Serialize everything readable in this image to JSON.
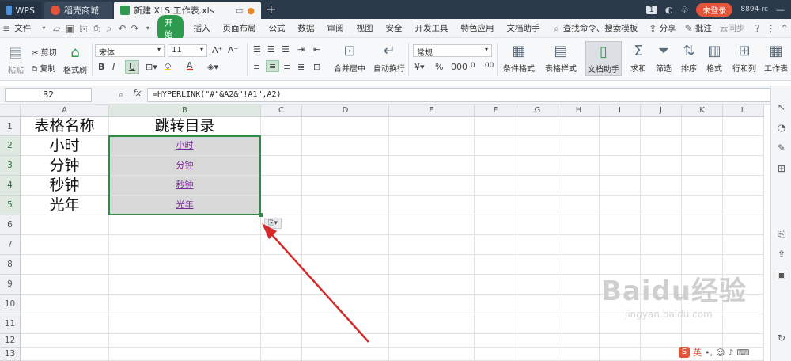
{
  "titlebar": {
    "app_tab": "WPS",
    "store_tab": "稻壳商城",
    "file_tab": "新建 XLS 工作表.xls",
    "badge": "1",
    "login": "未登录",
    "user": "8894-rc"
  },
  "menu": {
    "file": "文件",
    "start": "开始",
    "items": [
      "插入",
      "页面布局",
      "公式",
      "数据",
      "审阅",
      "视图",
      "安全",
      "开发工具",
      "特色应用",
      "文档助手"
    ],
    "search": "查找命令、搜索模板",
    "share": "分享",
    "comment": "批注",
    "sync": "云同步"
  },
  "ribbon": {
    "paste": "粘贴",
    "cut": "剪切",
    "copy": "复制",
    "format_painter": "格式刷",
    "font_name": "宋体",
    "font_size": "11",
    "merge_center": "合并居中",
    "wrap": "自动换行",
    "number_format": "常规",
    "cond_format": "条件格式",
    "table_style": "表格样式",
    "doc_assist": "文档助手",
    "sum": "求和",
    "filter": "筛选",
    "sort": "排序",
    "format": "格式",
    "rowcol": "行和列",
    "sheet": "工作表"
  },
  "formula_bar": {
    "name_box": "B2",
    "fx": "fx",
    "formula": "=HYPERLINK(\"#\"&A2&\"!A1\",A2)"
  },
  "sheet": {
    "columns": [
      "A",
      "B",
      "C",
      "D",
      "E",
      "F",
      "G",
      "H",
      "I",
      "J",
      "K",
      "L"
    ],
    "rows": [
      "1",
      "2",
      "3",
      "4",
      "5",
      "6",
      "7",
      "8",
      "9",
      "10",
      "11",
      "12",
      "13"
    ],
    "cells": {
      "A1": "表格名称",
      "B1": "跳转目录",
      "A2": "小时",
      "A3": "分钟",
      "A4": "秒钟",
      "A5": "光年",
      "B2": "小时",
      "B3": "分钟",
      "B4": "秒钟",
      "B5": "光年"
    }
  },
  "watermark": {
    "text": "Baidu经验",
    "url": "jingyan.baidu.com"
  },
  "ime": {
    "lang": "英"
  },
  "colors": {
    "selection": "#2d8a47",
    "link": "#7a2aa0",
    "arrow": "#d62a2a",
    "start_button": "#2d9a4f"
  }
}
